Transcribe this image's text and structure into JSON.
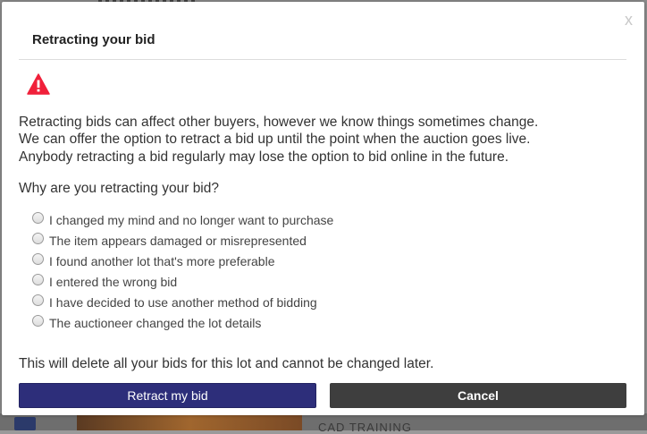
{
  "dialog": {
    "close_label": "x",
    "title": "Retracting your bid",
    "warning_icon": "warning-triangle-icon",
    "warning_color": "#f0203a",
    "description_lines": [
      "Retracting bids can affect other buyers, however we know things sometimes change.",
      "We can offer the option to retract a bid up until the point when the auction goes live.",
      "Anybody retracting a bid regularly may lose the option to bid online in the future."
    ],
    "question": "Why are you retracting your bid?",
    "reasons": [
      "I changed my mind and no longer want to purchase",
      "The item appears damaged or misrepresented",
      "I found another lot that's more preferable",
      "I entered the wrong bid",
      "I have decided to use another method of bidding",
      "The auctioneer changed the lot details"
    ],
    "notice": "This will delete all your bids for this lot and cannot be changed later.",
    "retract_button": "Retract my bid",
    "cancel_button": "Cancel",
    "colors": {
      "retract_bg": "#2d2e7a",
      "cancel_bg": "#3e3e3e"
    }
  },
  "background": {
    "peek_text": "CAD TRAINING"
  }
}
